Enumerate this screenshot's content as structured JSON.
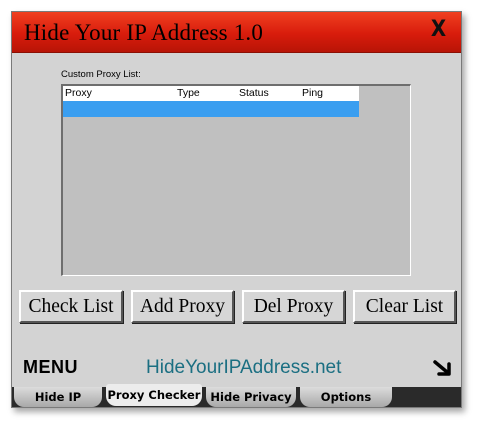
{
  "window": {
    "title": "Hide Your IP Address 1.0",
    "close_label": "X"
  },
  "proxy_list": {
    "label": "Custom Proxy List:",
    "columns": [
      "Proxy",
      "Type",
      "Status",
      "Ping"
    ]
  },
  "buttons": {
    "check_list": "Check List",
    "add_proxy": "Add Proxy",
    "del_proxy": "Del Proxy",
    "clear_list": "Clear List"
  },
  "footer": {
    "menu_label": "MENU",
    "website": "HideYourIPAddress.net",
    "corner_icon": "diagonal-arrow-icon"
  },
  "tabs": [
    {
      "label": "Hide IP",
      "active": false
    },
    {
      "label": "Proxy Checker",
      "active": true
    },
    {
      "label": "Hide Privacy",
      "active": false
    },
    {
      "label": "Options",
      "active": false
    }
  ],
  "colors": {
    "title_bar": "#d81c0c",
    "selection": "#3a9ef0",
    "website_text": "#1b6f82",
    "panel": "#d3d3d3"
  }
}
